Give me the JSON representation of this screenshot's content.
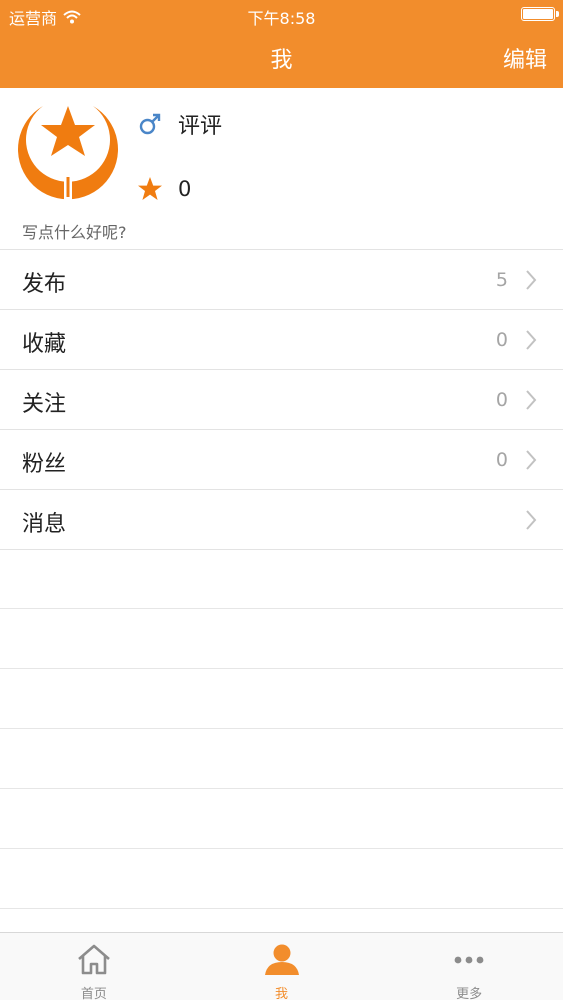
{
  "status_bar": {
    "carrier": "运营商",
    "time": "下午8:58"
  },
  "nav": {
    "title": "我",
    "edit_label": "编辑"
  },
  "profile": {
    "username": "评评",
    "gender_icon": "male-icon",
    "score": "0",
    "signature": "写点什么好呢?"
  },
  "menu": [
    {
      "label": "发布",
      "count": "5"
    },
    {
      "label": "收藏",
      "count": "0"
    },
    {
      "label": "关注",
      "count": "0"
    },
    {
      "label": "粉丝",
      "count": "0"
    },
    {
      "label": "消息",
      "count": ""
    }
  ],
  "tabs": [
    {
      "label": "首页",
      "icon": "home-icon"
    },
    {
      "label": "我",
      "icon": "person-icon",
      "active": true
    },
    {
      "label": "更多",
      "icon": "more-icon"
    }
  ],
  "colors": {
    "brand": "#f28d2c",
    "male": "#4a86c8",
    "muted": "#a5a5a5",
    "tab_inactive": "#8c8c8c"
  }
}
